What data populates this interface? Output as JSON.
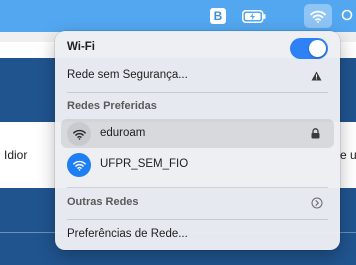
{
  "background": {
    "left_fragment": "Idior",
    "right_fragment": "e u"
  },
  "menubar": {
    "app_icon_letter": "B",
    "battery_icon": "battery-charging-icon",
    "wifi_icon": "wifi-icon",
    "search_icon": "spotlight-search-icon"
  },
  "wifi_menu": {
    "title": "Wi-Fi",
    "toggle_on": true,
    "unsecured_network": {
      "label": "Rede sem Segurança...",
      "icon": "warning-icon"
    },
    "preferred_section_label": "Redes Preferidas",
    "networks": [
      {
        "name": "eduroam",
        "locked": true,
        "connected": false,
        "icon": "wifi-icon"
      },
      {
        "name": "UFPR_SEM_FIO",
        "locked": false,
        "connected": true,
        "icon": "wifi-icon"
      }
    ],
    "other_networks_label": "Outras Redes",
    "other_networks_icon": "chevron-right-icon",
    "preferences_label": "Preferências de Rede..."
  },
  "colors": {
    "menubar": "#53a7f0",
    "toggle_active": "#2f82f5",
    "connected_network": "#1e7ef3",
    "page_banner": "#20548f"
  }
}
